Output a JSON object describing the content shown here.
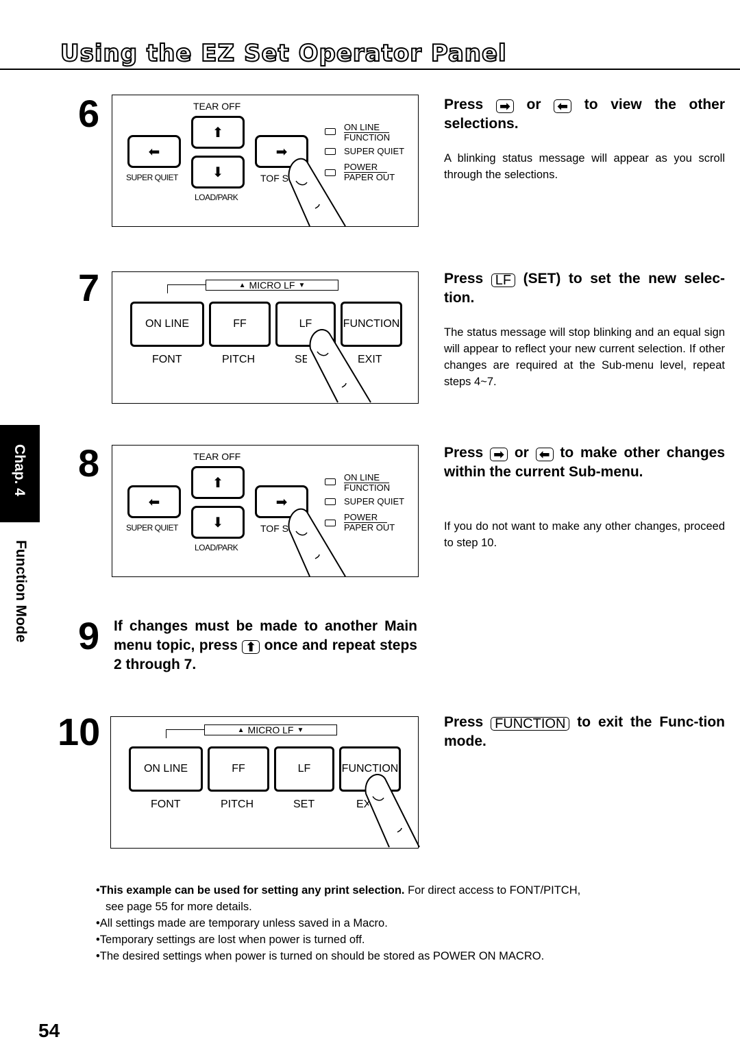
{
  "page": {
    "title": "Using the EZ Set Operator Panel",
    "page_number": "54",
    "side_tab": {
      "chapter": "Chap. 4",
      "section": "Function Mode"
    }
  },
  "icons": {
    "right_arrow": "➡",
    "left_arrow": "⬅",
    "up_arrow": "⬆",
    "down_arrow": "⬇",
    "micro_up": "▲",
    "micro_down": "▼"
  },
  "arrow_panel": {
    "top_label": "TEAR OFF",
    "bottom_label": "LOAD/PARK",
    "left_label": "SUPER QUIET",
    "right_label": "TOF S",
    "leds": [
      {
        "top": "ON LINE",
        "bottom": "FUNCTION"
      },
      {
        "single": "SUPER QUIET"
      },
      {
        "top": "POWER",
        "bottom": "PAPER  OUT"
      }
    ]
  },
  "function_panel": {
    "micro_label": "MICRO LF",
    "keys": [
      "ON LINE",
      "FF",
      "LF",
      "FUNCTION"
    ],
    "sub_labels": [
      "FONT",
      "PITCH",
      "SET",
      "EXIT"
    ]
  },
  "steps": [
    {
      "number": "6",
      "heading_parts": [
        "Press",
        "or",
        "to view the other selections."
      ],
      "body": "A blinking status message will appear as you scroll through the selections."
    },
    {
      "number": "7",
      "heading_parts": [
        "Press",
        "LF",
        "(SET) to set the new selec-tion."
      ],
      "body": "The status message will stop blinking and an equal sign will appear to reflect your new current selection. If other changes are required at the Sub-menu level, repeat steps 4~7."
    },
    {
      "number": "8",
      "heading_parts": [
        "Press",
        "or",
        "to make other changes within the current Sub-menu."
      ],
      "body": "If you do not want to make any other changes, proceed to step 10."
    },
    {
      "number": "9",
      "heading_parts": [
        "If changes must be made to another Main menu topic, press",
        "once and repeat steps 2 through 7."
      ]
    },
    {
      "number": "10",
      "heading_parts": [
        "Press",
        "FUNCTION",
        "to exit the Func-tion mode."
      ]
    }
  ],
  "notes": {
    "first_bold": "This example can be used for setting any print selection.",
    "first_rest": " For direct access to FONT/PITCH,",
    "first_cont": "see page 55 for more details.",
    "items": [
      "All settings made are temporary unless saved in a Macro.",
      "Temporary settings are lost when power is turned off.",
      "The desired settings when power is turned on should be stored as POWER ON MACRO."
    ],
    "bullet": "•"
  }
}
